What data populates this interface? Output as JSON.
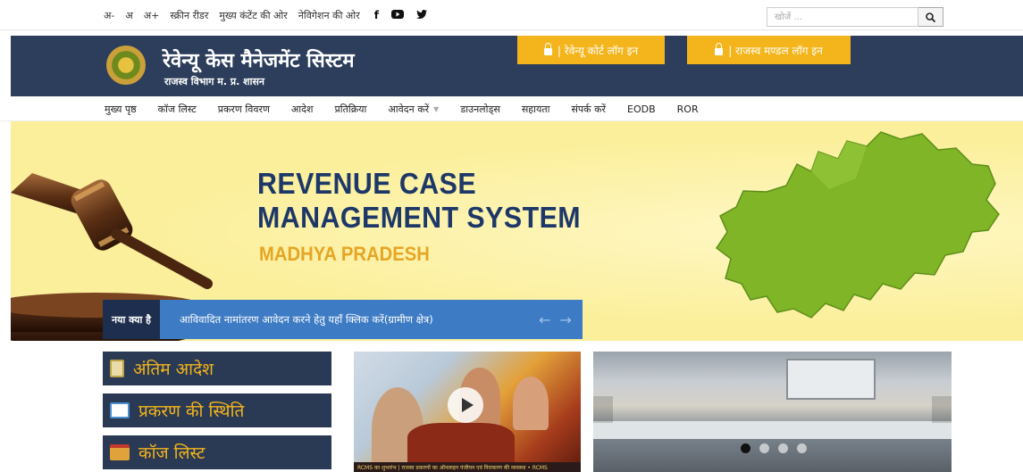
{
  "topbar": {
    "font_decrease": "अ-",
    "font_normal": "अ",
    "font_increase": "अ+",
    "screen_reader": "स्क्रीन रीडर",
    "skip_content": "मुख्य कंटेंट की ओर",
    "skip_nav": "नेविगेशन की ओर",
    "social": {
      "facebook": "f",
      "youtube": "▶",
      "twitter": "y"
    },
    "search_placeholder": "खोजें ...",
    "search_icon": "search-icon"
  },
  "header": {
    "title": "रेवेन्यू केस मैनेजमेंट सिस्टम",
    "subtitle": "राजस्व विभाग म. प्र. शासन",
    "court_login": "| रेवेन्यू कोर्ट लॉग इन",
    "board_login": "| राजस्व मण्डल लॉग इन",
    "colors": {
      "header_bg": "#2c3e5b",
      "accent": "#f3b51b"
    }
  },
  "nav": {
    "items": [
      {
        "label": "मुख्य पृष्ठ"
      },
      {
        "label": "कॉज लिस्ट"
      },
      {
        "label": "प्रकरण विवरण"
      },
      {
        "label": "आदेश"
      },
      {
        "label": "प्रतिक्रिया"
      },
      {
        "label": "आवेदन करें",
        "caret": "▼"
      },
      {
        "label": "डाउनलोड्स"
      },
      {
        "label": "सहायता"
      },
      {
        "label": "संपर्क करें"
      },
      {
        "label": "EODB"
      },
      {
        "label": "ROR"
      }
    ]
  },
  "banner": {
    "title_line1": "REVENUE CASE",
    "title_line2": "MANAGEMENT SYSTEM",
    "subtitle": "MADHYA PRADESH"
  },
  "ticker": {
    "label": "नया क्या है",
    "message": "आविवादित नामांतरण आवेदन करने हेतु यहाँ क्लिक करें(ग्रामीण क्षेत्र)",
    "prev": "←",
    "next": "→"
  },
  "quick_links": [
    {
      "label": "अंतिम आदेश",
      "icon": "document-icon"
    },
    {
      "label": "प्रकरण की स्थिति",
      "icon": "id-card-icon"
    },
    {
      "label": "कॉज लिस्ट",
      "icon": "calendar-icon"
    }
  ],
  "video": {
    "caption": "RCMS का शुभारंभ | राजस्व प्रकरणों का ऑनलाइन पंजीयन एवं निराकरण की व्यवस्था • RCMS"
  },
  "photo_slider": {
    "slide_count": 4,
    "active_index": 0
  }
}
